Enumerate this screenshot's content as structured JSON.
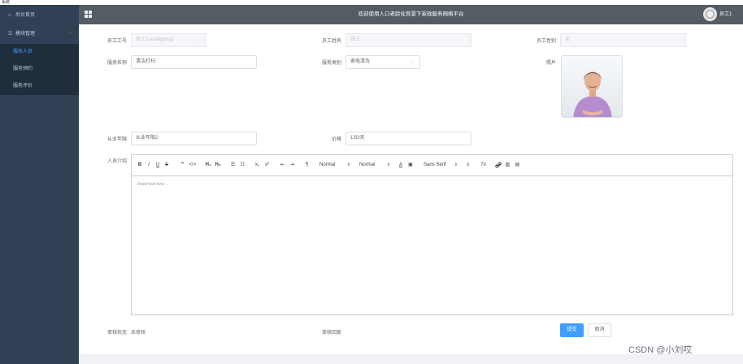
{
  "window": {
    "title_fragment": "系统"
  },
  "sidebar": {
    "home": {
      "label": "后台首页",
      "icon": "home-icon"
    },
    "module": {
      "label": "模块管理",
      "icon": "menu-grid-icon"
    },
    "items": [
      {
        "label": "服务人员",
        "active": true
      },
      {
        "label": "服务预约",
        "active": false
      },
      {
        "label": "服务评价",
        "active": false
      }
    ]
  },
  "header": {
    "title": "欢迎使用人口老龄化背景下家政服务网络平台",
    "user": "员工1"
  },
  "form": {
    "staff_id": {
      "label": "员工工号",
      "value": "员工1-yuangong1"
    },
    "staff_name": {
      "label": "员工姓名",
      "value": "张三"
    },
    "staff_gender": {
      "label": "员工性别",
      "value": "女"
    },
    "service_name": {
      "label": "服务名称",
      "value": "清洁打扫"
    },
    "service_type": {
      "label": "服务类别",
      "value": "家电清洗"
    },
    "photo": {
      "label": "照片"
    },
    "experience": {
      "label": "从业年限",
      "value": "从业年限2"
    },
    "price": {
      "label": "价格",
      "value": "130/天"
    },
    "intro": {
      "label": "人员介绍",
      "placeholder": "Insert text here ..."
    },
    "audit_status": {
      "label": "审核状态",
      "value": "未审核"
    },
    "audit_reply": {
      "label": "审核回复"
    }
  },
  "toolbar": {
    "bold": "B",
    "italic": "I",
    "underline": "U",
    "strike": "S",
    "quote": "❞",
    "code": "</>",
    "h1": "H₁",
    "h2": "H₂",
    "ol": "☰",
    "ul": "☷",
    "sub": "x₂",
    "sup": "x²",
    "outdent": "⇤",
    "indent": "⇥",
    "direction": "¶",
    "size": "Normal",
    "header": "Normal",
    "color": "A",
    "background": "▣",
    "font": "Sans Serif",
    "align": "≡",
    "clean": "Tx",
    "link": "🔗",
    "image": "▨",
    "video": "▤"
  },
  "actions": {
    "submit": "提交",
    "cancel": "取消"
  },
  "watermark": "CSDN @小刘哎",
  "colors": {
    "sidebar": "#304156",
    "header": "#545c64",
    "primary": "#409eff",
    "active_menu": "#409eff"
  }
}
